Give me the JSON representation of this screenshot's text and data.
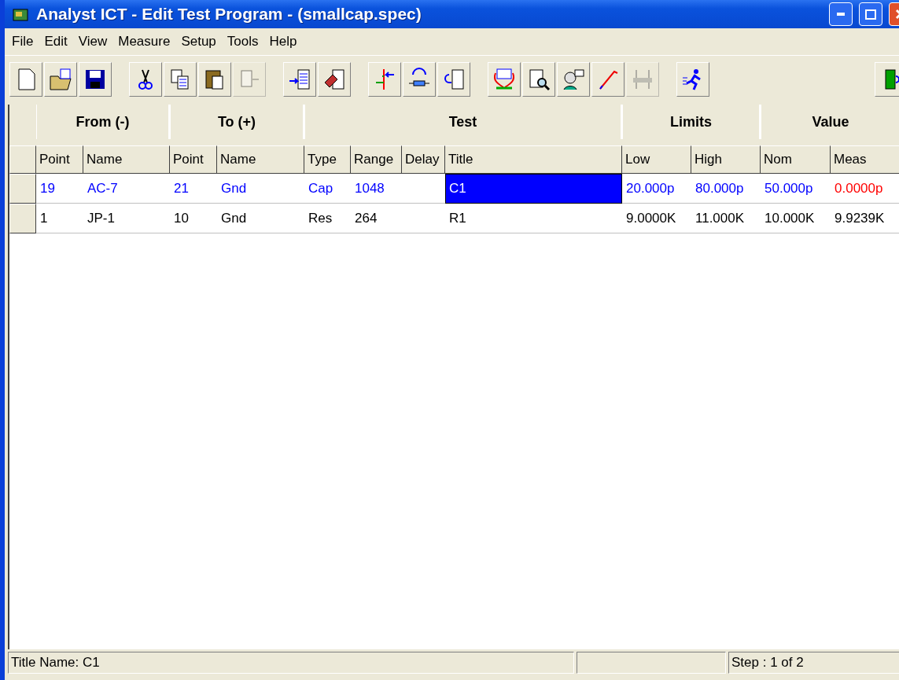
{
  "window": {
    "title": "Analyst ICT - Edit Test Program - (smallcap.spec)"
  },
  "menu": [
    "File",
    "Edit",
    "View",
    "Measure",
    "Setup",
    "Tools",
    "Help"
  ],
  "toolbar": [
    [
      {
        "disabled": false
      },
      {
        "disabled": false
      },
      {
        "disabled": false
      }
    ],
    [
      {
        "disabled": false
      },
      {
        "disabled": false
      },
      {
        "disabled": false
      },
      {
        "disabled": true
      }
    ],
    [
      {
        "disabled": false
      },
      {
        "disabled": false
      }
    ],
    [
      {
        "disabled": false
      },
      {
        "disabled": false
      },
      {
        "disabled": false
      }
    ],
    [
      {
        "disabled": false
      },
      {
        "disabled": false
      },
      {
        "disabled": false
      },
      {
        "disabled": false
      },
      {
        "disabled": true
      }
    ],
    [
      {
        "disabled": false
      }
    ],
    [
      {
        "disabled": false
      }
    ]
  ],
  "table": {
    "groups": [
      "From (-)",
      "To (+)",
      "Test",
      "Limits",
      "Value"
    ],
    "columns": [
      "Point",
      "Name",
      "Point",
      "Name",
      "Type",
      "Range",
      "Delay",
      "Title",
      "Low",
      "High",
      "Nom",
      "Meas"
    ],
    "rows": [
      {
        "selected": true,
        "meas_failed": true,
        "cells": [
          "19",
          "AC-7",
          "21",
          "Gnd",
          "Cap",
          "1048",
          "",
          "C1",
          "20.000p",
          "80.000p",
          "50.000p",
          "0.0000p"
        ]
      },
      {
        "selected": false,
        "meas_failed": false,
        "cells": [
          "1",
          "JP-1",
          "10",
          "Gnd",
          "Res",
          "264",
          "",
          "R1",
          "9.0000K",
          "11.000K",
          "10.000K",
          "9.9239K"
        ]
      }
    ]
  },
  "status_bar": {
    "left": "Title Name: C1",
    "right": "Step : 1 of 2"
  }
}
